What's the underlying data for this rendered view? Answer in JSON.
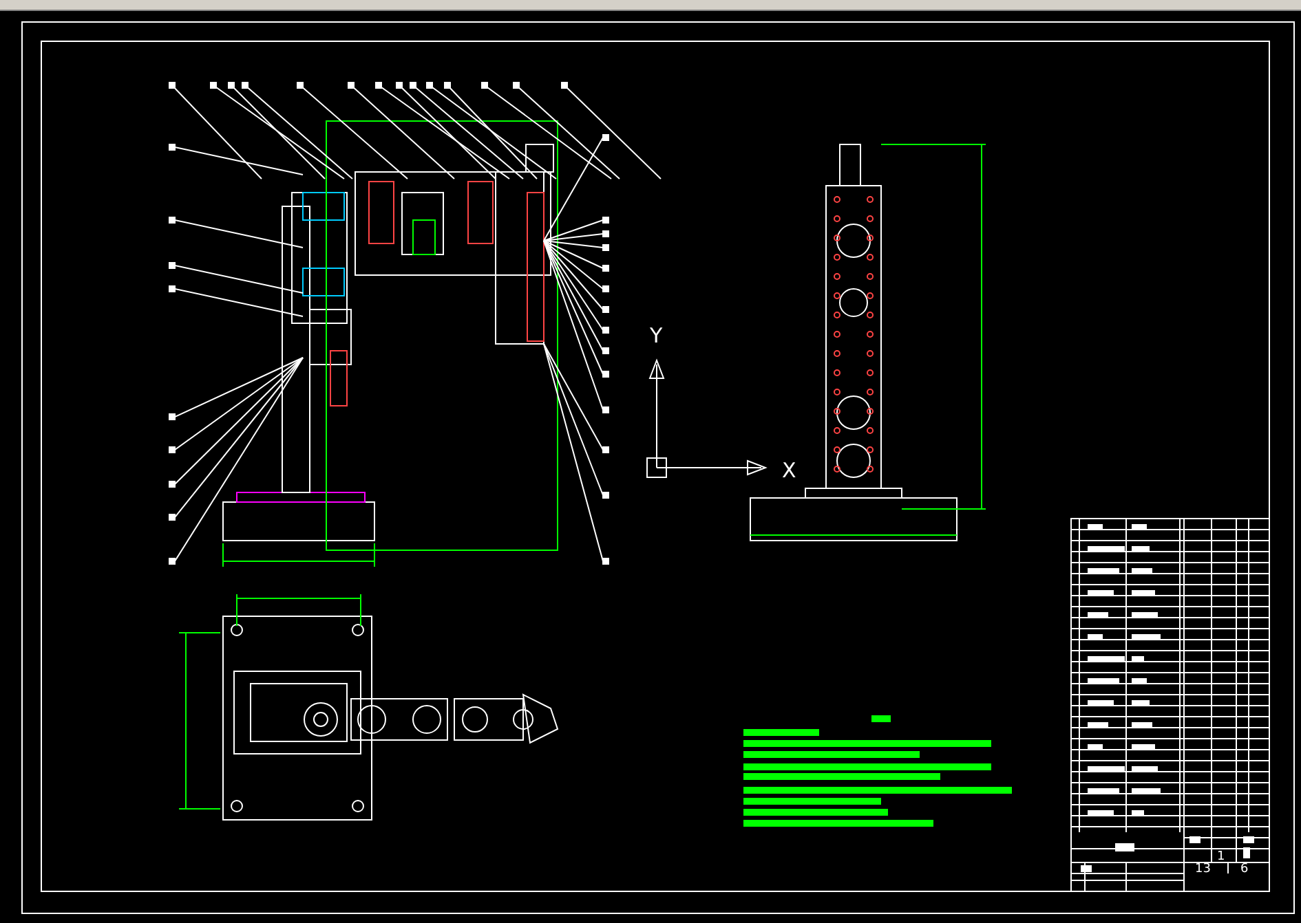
{
  "ucs_icon": {
    "y_label": "Y",
    "x_label": "X"
  },
  "title_block": {
    "quantity": "1",
    "sheet_total": "13",
    "sheet_number": "6"
  }
}
